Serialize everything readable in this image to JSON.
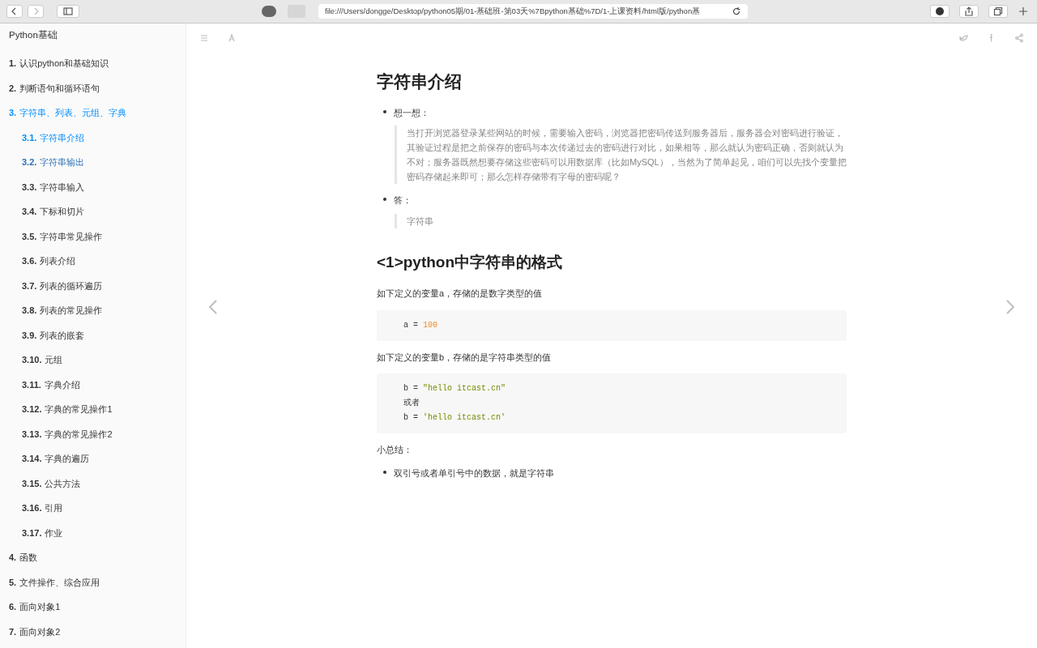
{
  "browser": {
    "url": "file:///Users/dongge/Desktop/python05期/01-基础班-第03天%7Bpython基础%7D/1-上课资料/html版/python基"
  },
  "sidebar": {
    "title": "Python基础",
    "items": [
      {
        "number": "1.",
        "label": "认识python和基础知识",
        "selected": false,
        "hovered": false
      },
      {
        "number": "2.",
        "label": "判断语句和循环语句",
        "selected": false,
        "hovered": false
      },
      {
        "number": "3.",
        "label": "字符串、列表、元组、字典",
        "selected": true,
        "children": [
          {
            "number": "3.1.",
            "label": "字符串介绍",
            "selected": true
          },
          {
            "number": "3.2.",
            "label": "字符串输出",
            "selected": false,
            "hovered": true
          },
          {
            "number": "3.3.",
            "label": "字符串输入",
            "selected": false,
            "hovered": false
          },
          {
            "number": "3.4.",
            "label": "下标和切片",
            "selected": false,
            "hovered": false
          },
          {
            "number": "3.5.",
            "label": "字符串常见操作",
            "selected": false,
            "hovered": false
          },
          {
            "number": "3.6.",
            "label": "列表介绍",
            "selected": false,
            "hovered": false
          },
          {
            "number": "3.7.",
            "label": "列表的循环遍历",
            "selected": false,
            "hovered": false
          },
          {
            "number": "3.8.",
            "label": "列表的常见操作",
            "selected": false,
            "hovered": false
          },
          {
            "number": "3.9.",
            "label": "列表的嵌套",
            "selected": false,
            "hovered": false
          },
          {
            "number": "3.10.",
            "label": "元组",
            "selected": false,
            "hovered": false
          },
          {
            "number": "3.11.",
            "label": "字典介绍",
            "selected": false,
            "hovered": false
          },
          {
            "number": "3.12.",
            "label": "字典的常见操作1",
            "selected": false,
            "hovered": false
          },
          {
            "number": "3.13.",
            "label": "字典的常见操作2",
            "selected": false,
            "hovered": false
          },
          {
            "number": "3.14.",
            "label": "字典的遍历",
            "selected": false,
            "hovered": false
          },
          {
            "number": "3.15.",
            "label": "公共方法",
            "selected": false,
            "hovered": false
          },
          {
            "number": "3.16.",
            "label": "引用",
            "selected": false,
            "hovered": false
          },
          {
            "number": "3.17.",
            "label": "作业",
            "selected": false,
            "hovered": false
          }
        ]
      },
      {
        "number": "4.",
        "label": "函数",
        "selected": false,
        "hovered": false
      },
      {
        "number": "5.",
        "label": "文件操作、综合应用",
        "selected": false,
        "hovered": false
      },
      {
        "number": "6.",
        "label": "面向对象1",
        "selected": false,
        "hovered": false
      },
      {
        "number": "7.",
        "label": "面向对象2",
        "selected": false,
        "hovered": false
      }
    ]
  },
  "content": {
    "title": "字符串介绍",
    "blocks": [
      {
        "kind": "bullet",
        "text": "想一想："
      },
      {
        "kind": "quote",
        "text": "当打开浏览器登录某些网站的时候，需要输入密码，浏览器把密码传送到服务器后，服务器会对密码进行验证，其验证过程是把之前保存的密码与本次传递过去的密码进行对比，如果相等，那么就认为密码正确，否则就认为不对；服务器既然想要存储这些密码可以用数据库（比如MySQL），当然为了简单起见，咱们可以先找个变量把密码存储起来即可；那么怎样存储带有字母的密码呢？"
      },
      {
        "kind": "bullet",
        "text": "答："
      },
      {
        "kind": "quote",
        "text": "字符串"
      },
      {
        "kind": "heading",
        "text": "<1>python中字符串的格式"
      },
      {
        "kind": "paragraph",
        "text": "如下定义的变量a，存储的是数字类型的值"
      },
      {
        "kind": "code",
        "lines": [
          {
            "parts": [
              {
                "text": "a = ",
                "kind": "plain"
              },
              {
                "text": "100",
                "kind": "number"
              }
            ]
          }
        ]
      },
      {
        "kind": "paragraph",
        "text": "如下定义的变量b，存储的是字符串类型的值"
      },
      {
        "kind": "code",
        "lines": [
          {
            "parts": [
              {
                "text": "b = ",
                "kind": "plain"
              },
              {
                "text": "\"hello itcast.cn\"",
                "kind": "string"
              }
            ]
          },
          {
            "parts": [
              {
                "text": "或者",
                "kind": "plain"
              }
            ]
          },
          {
            "parts": [
              {
                "text": "b = ",
                "kind": "plain"
              },
              {
                "text": "'hello itcast.cn'",
                "kind": "string"
              }
            ]
          }
        ]
      },
      {
        "kind": "paragraph",
        "text": "小总结："
      },
      {
        "kind": "bullet",
        "text": "双引号或者单引号中的数据，就是字符串"
      }
    ]
  }
}
